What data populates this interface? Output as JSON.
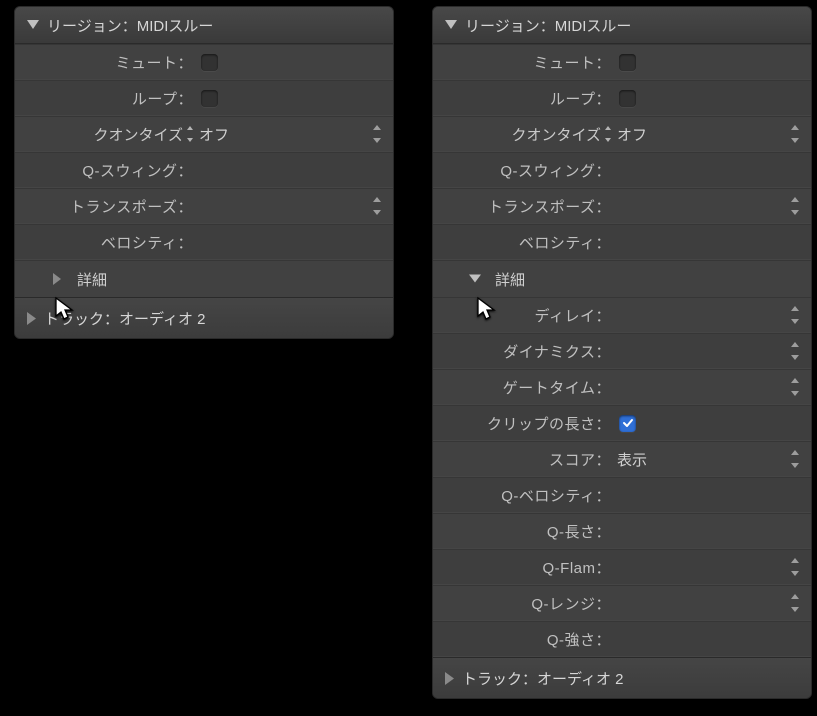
{
  "left": {
    "header": "リージョン：MIDIスルー",
    "mute": "ミュート：",
    "loop": "ループ：",
    "quantize_label": "クオンタイズ",
    "quantize_value": "オフ",
    "q_swing": "Q-スウィング：",
    "transpose": "トランスポーズ：",
    "velocity": "ベロシティ：",
    "details": "詳細",
    "track": "トラック：オーディオ 2"
  },
  "right": {
    "header": "リージョン：MIDIスルー",
    "mute": "ミュート：",
    "loop": "ループ：",
    "quantize_label": "クオンタイズ",
    "quantize_value": "オフ",
    "q_swing": "Q-スウィング：",
    "transpose": "トランスポーズ：",
    "velocity": "ベロシティ：",
    "details": "詳細",
    "delay": "ディレイ：",
    "dynamics": "ダイナミクス：",
    "gate_time": "ゲートタイム：",
    "clip_length": "クリップの長さ：",
    "score": "スコア：",
    "score_value": "表示",
    "q_velocity": "Q-ベロシティ：",
    "q_length": "Q-長さ：",
    "q_flam": "Q-Flam：",
    "q_range": "Q-レンジ：",
    "q_strength": "Q-強さ：",
    "track": "トラック：オーディオ 2"
  }
}
